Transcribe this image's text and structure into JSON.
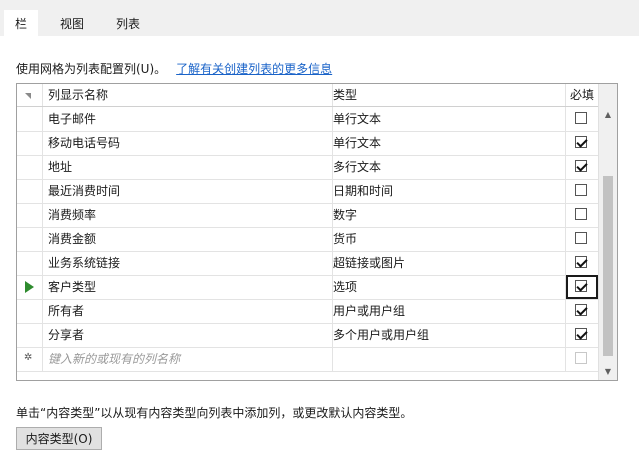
{
  "tabs": [
    {
      "label": "栏",
      "active": true
    },
    {
      "label": "视图",
      "active": false
    },
    {
      "label": "列表",
      "active": false
    }
  ],
  "instruction": {
    "text": "使用网格为列表配置列(U)。",
    "link": "了解有关创建列表的更多信息"
  },
  "grid": {
    "headers": {
      "name": "列显示名称",
      "type": "类型",
      "required": "必填"
    },
    "rows": [
      {
        "name": "电子邮件",
        "type": "单行文本",
        "required": false
      },
      {
        "name": "移动电话号码",
        "type": "单行文本",
        "required": true
      },
      {
        "name": "地址",
        "type": "多行文本",
        "required": true
      },
      {
        "name": "最近消费时间",
        "type": "日期和时间",
        "required": false
      },
      {
        "name": "消费频率",
        "type": "数字",
        "required": false
      },
      {
        "name": "消费金额",
        "type": "货币",
        "required": false
      },
      {
        "name": "业务系统链接",
        "type": "超链接或图片",
        "required": true
      },
      {
        "name": "客户类型",
        "type": "选项",
        "required": true,
        "selected": true
      },
      {
        "name": "所有者",
        "type": "用户或用户组",
        "required": true
      },
      {
        "name": "分享者",
        "type": "多个用户或用户组",
        "required": true
      }
    ],
    "new_row_placeholder": "键入新的或现有的列名称"
  },
  "footer": {
    "note": "单击“内容类型”以从现有内容类型向列表中添加列，或更改默认内容类型。",
    "button_label": "内容类型(O)"
  },
  "colors": {
    "link": "#1a63c8",
    "row_indicator": "#2e8b2e"
  }
}
